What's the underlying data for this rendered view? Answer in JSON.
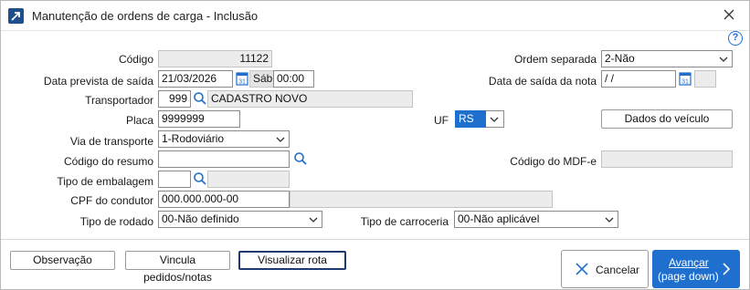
{
  "window": {
    "title": "Manutenção de ordens de carga - Inclusão"
  },
  "form": {
    "codigo": {
      "label": "Código",
      "value": "11122"
    },
    "ordem_separada": {
      "label": "Ordem separada",
      "value": "2-Não"
    },
    "data_prevista": {
      "label": "Data prevista de saída",
      "date": "21/03/2026",
      "weekday": "Sáb",
      "time": "00:00"
    },
    "data_saida_nota": {
      "label": "Data de saída da nota",
      "date": " / /",
      "time": ""
    },
    "transportador": {
      "label": "Transportador",
      "code": "999",
      "name": "CADASTRO NOVO"
    },
    "placa": {
      "label": "Placa",
      "value": "9999999"
    },
    "uf": {
      "label": "UF",
      "value": "RS"
    },
    "dados_veiculo": {
      "label": "Dados do veículo"
    },
    "via_transporte": {
      "label": "Via de transporte",
      "value": "1-Rodoviário"
    },
    "codigo_resumo": {
      "label": "Código do resumo",
      "value": ""
    },
    "codigo_mdfe": {
      "label": "Código do MDF-e",
      "value": ""
    },
    "tipo_embalagem": {
      "label": "Tipo de embalagem",
      "code": "",
      "desc": ""
    },
    "cpf_condutor": {
      "label": "CPF do condutor",
      "value": "000.000.000-00",
      "name": ""
    },
    "tipo_rodado": {
      "label": "Tipo de rodado",
      "value": "00-Não definido"
    },
    "tipo_carroceria": {
      "label": "Tipo de carroceria",
      "value": "00-Não aplicável"
    }
  },
  "footer": {
    "observacao": "Observação",
    "vincula": "Vincula pedidos/notas",
    "visualizar": "Visualizar rota",
    "cancelar": "Cancelar",
    "avancar": "Avançar",
    "avancar_hint": "(page down)"
  },
  "icons": {
    "app": "app-arrow-icon",
    "close": "close-icon",
    "help": "help-icon",
    "search": "search-icon",
    "calendar": "calendar-icon",
    "chevron": "chevron-down-icon"
  },
  "colors": {
    "accent": "#1f6fcf",
    "focus_border": "#1f3a6e"
  }
}
